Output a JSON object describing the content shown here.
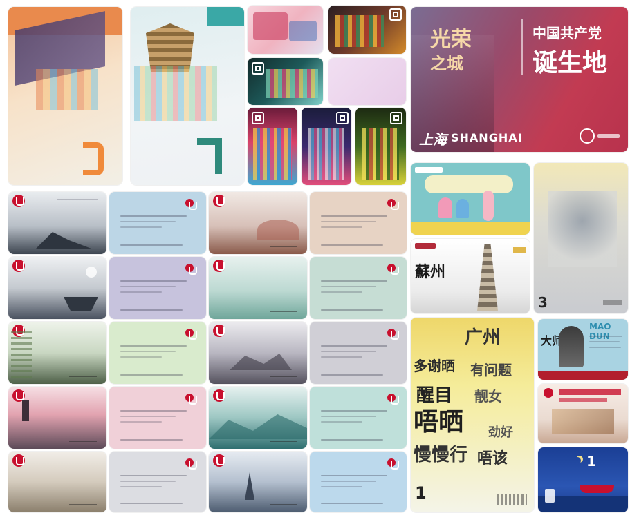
{
  "image": {
    "top_right_poster": {
      "left_lines": [
        "光荣",
        "之城"
      ],
      "right_lines": [
        "中国共产党",
        "诞生地"
      ],
      "city_cn": "上海",
      "city_en": "SHANGHAI"
    },
    "suzhou_card": {
      "title": "蘇州"
    },
    "guangzhou_card": {
      "words": [
        "广州",
        "多谢晒",
        "有问题",
        "醒目",
        "靓女",
        "唔晒",
        "劲好",
        "慢慢行",
        "唔该"
      ],
      "big_number": "1"
    },
    "mao_dun_card": {
      "english_title": "MAO DUN",
      "chinese_title": "大师"
    },
    "hangzhou_card_top": {
      "number": "3"
    },
    "small_card_number": "1"
  },
  "colors": {
    "poster_red": "#b8324d",
    "guangzhou_yellow": "#e8c93a",
    "mao_blue": "#7fb6c9",
    "night_blue": "#1c3f8f",
    "party_red": "#c8102e"
  }
}
